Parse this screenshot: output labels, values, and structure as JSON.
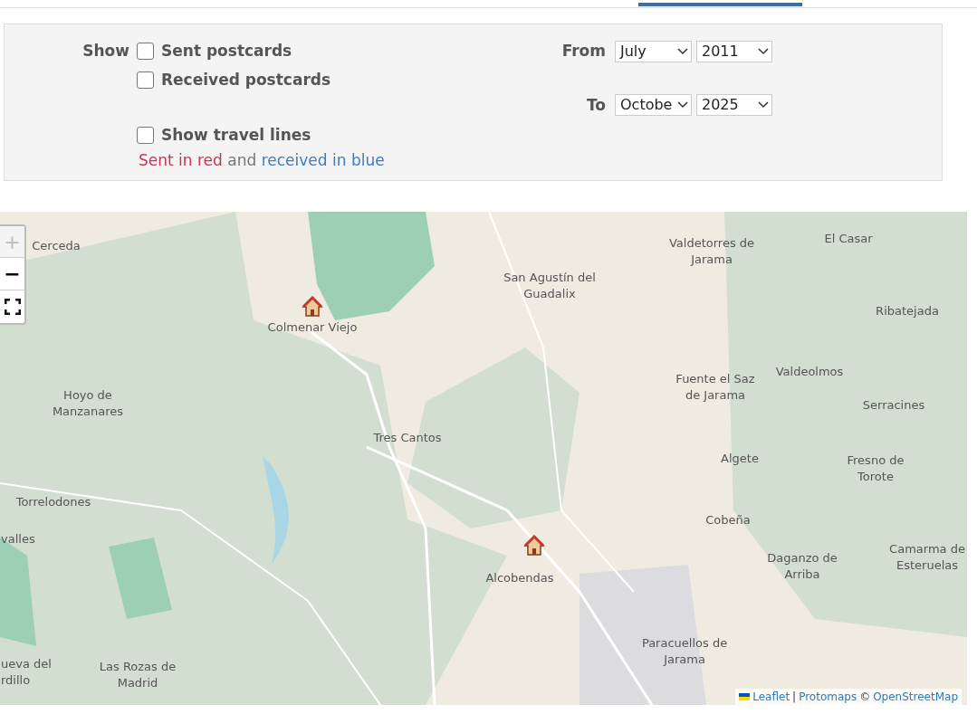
{
  "tabs": [
    {
      "selected": true
    }
  ],
  "filters": {
    "show_label": "Show",
    "options": [
      {
        "label": "Sent postcards",
        "checked": false
      },
      {
        "label": "Received postcards",
        "checked": false
      }
    ],
    "travel_lines": {
      "label": "Show travel lines",
      "checked": false
    },
    "legend": {
      "sent": "Sent in red",
      "joiner": "and",
      "received": "received in blue"
    },
    "from": {
      "label": "From",
      "month": "July",
      "year": "2011"
    },
    "to": {
      "label": "To",
      "month": "Octobe",
      "year": "2025"
    }
  },
  "map": {
    "zoom_in": {
      "label": "+",
      "disabled": true
    },
    "zoom_out": {
      "label": "−",
      "disabled": false
    },
    "labels": [
      "Cerceda",
      "Valdetorres de\nJarama",
      "El Casar",
      "San Agustín del\nGuadalix",
      "Ribatejada",
      "Colmenar Viejo",
      "Hoyo de\nManzanares",
      "Fuente el Saz\nde Jarama",
      "Valdeolmos",
      "Serracines",
      "Tres Cantos",
      "Algete",
      "Fresno de\nTorote",
      "Torrelodones",
      "Cobeña",
      "valles",
      "Daganzo de\nArriba",
      "Camarma de\nEsteruelas",
      "Alcobendas",
      "Paracuellos de\nJarama",
      "ueva del\nrdillo",
      "Las Rozas de\nMadrid"
    ],
    "markers": [
      {
        "kind": "house"
      },
      {
        "kind": "house"
      }
    ],
    "attribution": {
      "leaflet": "Leaflet",
      "separator": "|",
      "protomaps": "Protomaps",
      "copyright": "©",
      "osm": "OpenStreetMap"
    }
  }
}
